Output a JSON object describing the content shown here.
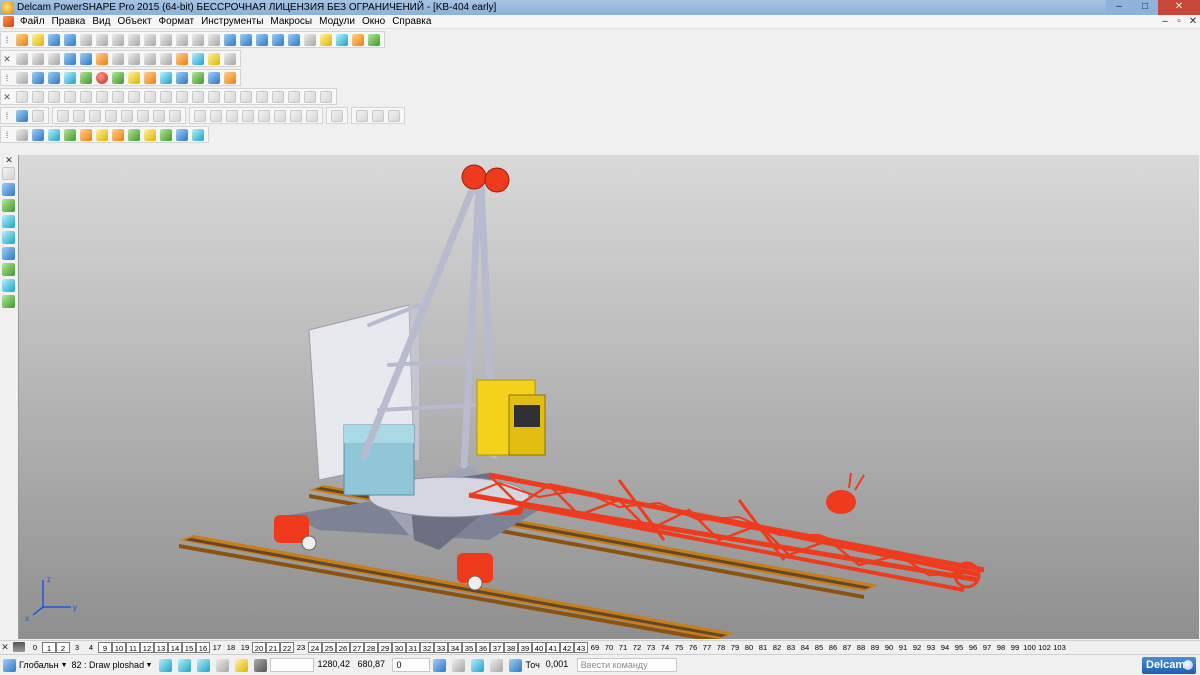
{
  "window": {
    "title": "Delcam PowerSHAPE Pro 2015 (64-bit) БЕССРОЧНАЯ ЛИЦЕНЗИЯ БЕЗ ОГРАНИЧЕНИЙ - [KB-404 early]",
    "controls": {
      "minimize": "–",
      "maximize": "□",
      "close": "✕"
    }
  },
  "menu": {
    "items": [
      "Файл",
      "Правка",
      "Вид",
      "Объект",
      "Формат",
      "Инструменты",
      "Макросы",
      "Модули",
      "Окно",
      "Справка"
    ],
    "mdi_controls": {
      "minimize": "–",
      "restore": "▫",
      "close": "✕"
    }
  },
  "toolbars": {
    "grip_close": "✕",
    "grip_handle": "⁞"
  },
  "viewport": {
    "background_top": "#d9d9d9",
    "background_bottom": "#8f8f8f",
    "model_colors": {
      "boom": "#ee3b1e",
      "mast": "#b9bbd0",
      "counterweight": "#8ec6d8",
      "cabin": "#f4d21c",
      "rails": "#d38a20"
    },
    "axis_labels": {
      "x": "x",
      "y": "y",
      "z": "z"
    }
  },
  "levels": {
    "close": "✕",
    "items": [
      "0",
      "1",
      "2",
      "3",
      "4",
      "9",
      "10",
      "11",
      "12",
      "13",
      "14",
      "15",
      "16",
      "17",
      "18",
      "19",
      "20",
      "21",
      "22",
      "23",
      "24",
      "25",
      "26",
      "27",
      "28",
      "29",
      "30",
      "31",
      "32",
      "33",
      "34",
      "35",
      "36",
      "37",
      "38",
      "39",
      "40",
      "41",
      "42",
      "43",
      "69",
      "70",
      "71",
      "72",
      "73",
      "74",
      "75",
      "76",
      "77",
      "78",
      "79",
      "80",
      "81",
      "82",
      "83",
      "84",
      "85",
      "86",
      "87",
      "88",
      "89",
      "90",
      "91",
      "92",
      "93",
      "94",
      "95",
      "96",
      "97",
      "98",
      "99",
      "100",
      "102",
      "103"
    ],
    "active": [
      "1",
      "2",
      "9",
      "10",
      "11",
      "12",
      "13",
      "14",
      "15",
      "16",
      "20",
      "21",
      "22",
      "24",
      "25",
      "26",
      "27",
      "28",
      "29",
      "30",
      "31",
      "32",
      "33",
      "34",
      "35",
      "36",
      "37",
      "38",
      "39",
      "40",
      "41",
      "42",
      "43"
    ]
  },
  "status": {
    "workplane": "Глобальн",
    "material": "82 : Draw ploshad",
    "coord_x": "1280,42",
    "coord_y": "680,87",
    "coord_z": "0",
    "tolerance_label": "Точ",
    "tolerance_value": "0,001",
    "command_placeholder": "Ввести команду",
    "dropdown_arrow": "▼",
    "logo": "Delcam"
  }
}
